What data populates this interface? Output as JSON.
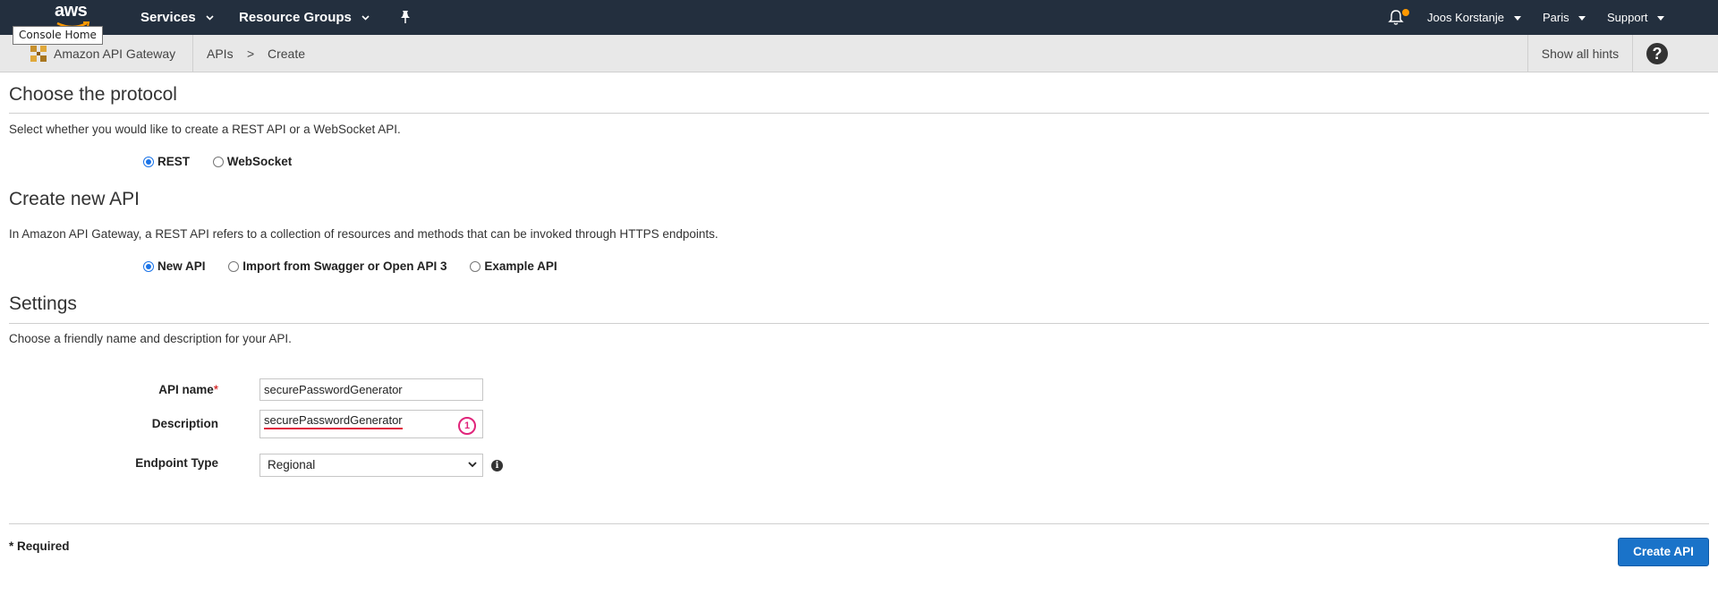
{
  "topnav": {
    "logo_text": "aws",
    "tooltip": "Console Home",
    "services": "Services",
    "resource_groups": "Resource Groups",
    "user": "Joos Korstanje",
    "region": "Paris",
    "support": "Support"
  },
  "subheader": {
    "service_name": "Amazon API Gateway",
    "breadcrumb": [
      "APIs",
      ">",
      "Create"
    ],
    "hints": "Show all hints",
    "help": "?"
  },
  "protocol": {
    "title": "Choose the protocol",
    "description": "Select whether you would like to create a REST API or a WebSocket API.",
    "options": [
      {
        "label": "REST",
        "selected": true
      },
      {
        "label": "WebSocket",
        "selected": false
      }
    ]
  },
  "create_api": {
    "title": "Create new API",
    "description": "In Amazon API Gateway, a REST API refers to a collection of resources and methods that can be invoked through HTTPS endpoints.",
    "options": [
      {
        "label": "New API",
        "selected": true
      },
      {
        "label": "Import from Swagger or Open API 3",
        "selected": false
      },
      {
        "label": "Example API",
        "selected": false
      }
    ]
  },
  "settings": {
    "title": "Settings",
    "description": "Choose a friendly name and description for your API.",
    "api_name_label": "API name",
    "api_name_required": "*",
    "api_name_value": "securePasswordGenerator",
    "description_label": "Description",
    "description_value": "securePasswordGenerator",
    "badge": "1",
    "endpoint_label": "Endpoint Type",
    "endpoint_value": "Regional"
  },
  "footer": {
    "required_note": "* Required",
    "create_button": "Create API"
  },
  "colors": {
    "nav_bg": "#232f3e",
    "accent": "#ff9900",
    "primary_button": "#1a73c9",
    "annotation": "#e0247a"
  }
}
